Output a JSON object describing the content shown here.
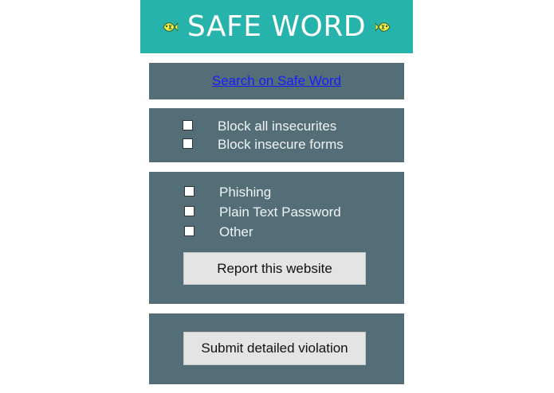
{
  "header": {
    "title": "SAFE WORD",
    "left_icon": "fish-icon",
    "right_icon": "fish-icon"
  },
  "search_panel": {
    "link_text": "Search on Safe Word"
  },
  "block_panel": {
    "options": [
      {
        "label": "Block all insecurites",
        "checked": false
      },
      {
        "label": "Block insecure forms",
        "checked": false
      }
    ]
  },
  "report_panel": {
    "options": [
      {
        "label": "Phishing",
        "checked": false
      },
      {
        "label": "Plain Text Password",
        "checked": false
      },
      {
        "label": "Other",
        "checked": false
      }
    ],
    "button_label": "Report this website"
  },
  "violation_panel": {
    "button_label": "Submit detailed violation"
  },
  "colors": {
    "header_bg": "#26b3ab",
    "panel_bg": "#546e78",
    "button_bg": "#e4e4e4",
    "link": "#1a1aff"
  }
}
